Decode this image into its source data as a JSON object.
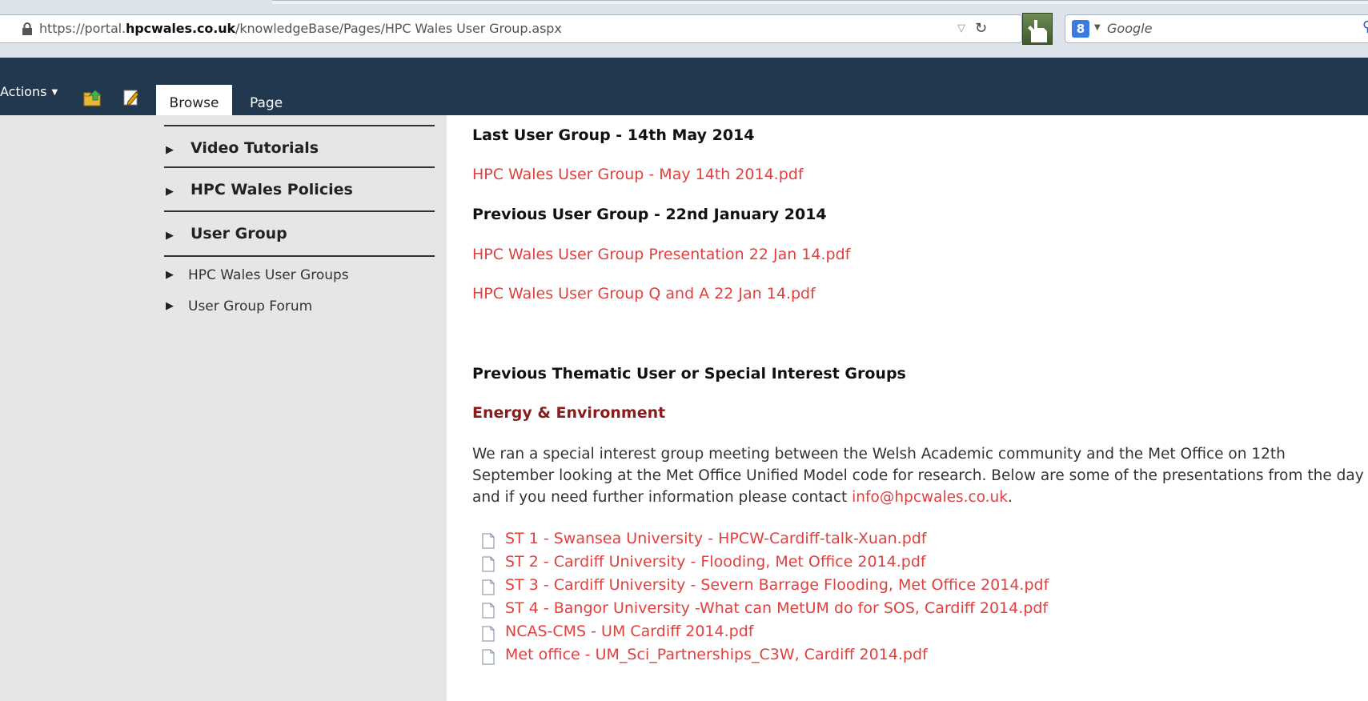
{
  "browser": {
    "url_prefix": "https://portal.",
    "url_domain": "hpcwales.co.uk",
    "url_path": "/knowledgeBase/Pages/HPC Wales User Group.aspx",
    "search_placeholder": "Google",
    "search_engine_glyph": "8"
  },
  "ribbon": {
    "actions_label": "Actions",
    "tabs": [
      {
        "label": "Browse",
        "selected": true
      },
      {
        "label": "Page",
        "selected": false
      }
    ],
    "bg_color": "#21384f"
  },
  "leftnav": {
    "sections": [
      {
        "label": "Video Tutorials"
      },
      {
        "label": "HPC Wales Policies"
      },
      {
        "label": "User Group"
      }
    ],
    "subitems": [
      {
        "label": "HPC Wales User Groups"
      },
      {
        "label": "User Group Forum"
      }
    ]
  },
  "content": {
    "last_heading": "Last User Group - 14th May 2014",
    "last_link": "HPC Wales User Group - May 14th 2014.pdf",
    "prev_heading": "Previous User Group - 22nd January 2014",
    "prev_links": [
      "HPC Wales User Group Presentation 22 Jan 14.pdf",
      "HPC Wales User Group Q and A 22 Jan 14.pdf"
    ],
    "thematic_heading": "Previous Thematic User or Special Interest Groups",
    "energy_heading": "Energy & Environment",
    "para_text": "We ran a special interest group meeting between the Welsh Academic community and the Met Office on 12th September looking at the Met Office Unified Model code for research.  Below are some of the presentations from the day and if you need further information please contact ",
    "para_email": "info@hpcwales.co.uk",
    "para_end": ".",
    "files": [
      "ST 1 - Swansea University - HPCW-Cardiff-talk-Xuan.pdf",
      "ST 2 - Cardiff University - Flooding, Met Office 2014.pdf",
      "ST 3 - Cardiff University - Severn Barrage Flooding, Met Office 2014.pdf",
      "ST 4 - Bangor University -What can MetUM do for SOS, Cardiff 2014.pdf",
      "NCAS-CMS - UM Cardiff 2014.pdf",
      "Met office - UM_Sci_Partnerships_C3W, Cardiff 2014.pdf"
    ],
    "link_color": "#e0403e",
    "heading_dark_color": "#8b1c1c"
  }
}
